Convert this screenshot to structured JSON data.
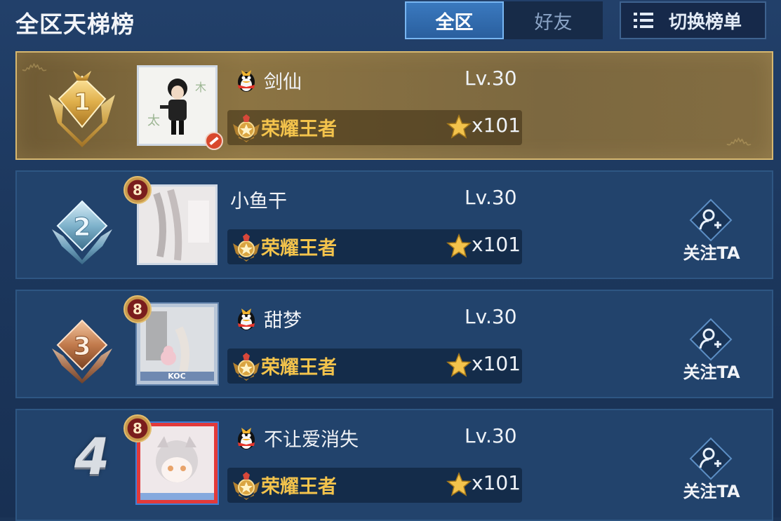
{
  "header": {
    "title": "全区天梯榜",
    "tabs": [
      {
        "label": "全区",
        "active": true
      },
      {
        "label": "好友",
        "active": false
      }
    ],
    "switch_label": "切换榜单",
    "switch_icon": "list-icon"
  },
  "entries": [
    {
      "rank": "1",
      "name": "剑仙",
      "level": "Lv.30",
      "tier": "荣耀王者",
      "stars": "x101",
      "level_badge": "",
      "follow_label": ""
    },
    {
      "rank": "2",
      "name": "小鱼干",
      "level": "Lv.30",
      "tier": "荣耀王者",
      "stars": "x101",
      "level_badge": "8",
      "follow_label": "关注TA"
    },
    {
      "rank": "3",
      "name": "甜梦",
      "level": "Lv.30",
      "tier": "荣耀王者",
      "stars": "x101",
      "level_badge": "8",
      "follow_label": "关注TA"
    },
    {
      "rank": "4",
      "name": "不让爱消失",
      "level": "Lv.30",
      "tier": "荣耀王者",
      "stars": "x101",
      "level_badge": "8",
      "follow_label": "关注TA"
    }
  ],
  "colors": {
    "background": "#1c375d",
    "tier_gold": "#f3c34c",
    "tab_active": "#3a79bf",
    "first_row_gold": "#8c7443"
  }
}
